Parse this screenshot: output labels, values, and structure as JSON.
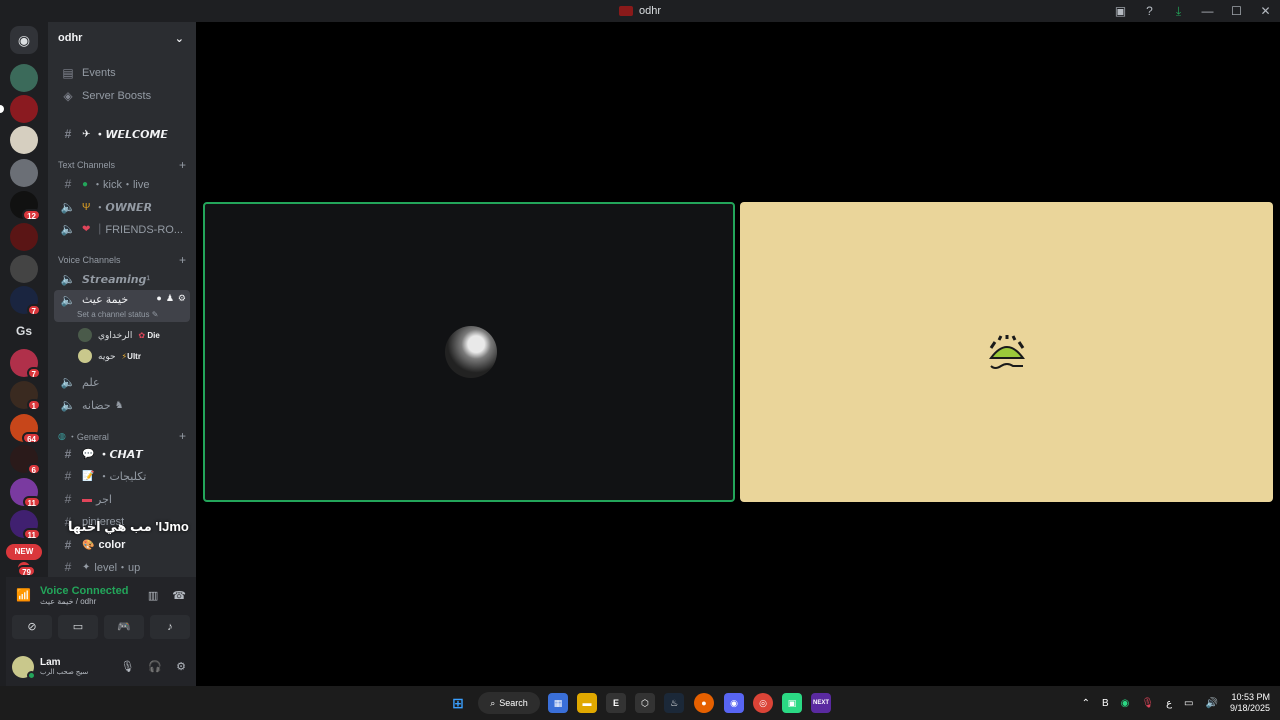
{
  "window": {
    "title": "odhr"
  },
  "server": {
    "name": "odhr"
  },
  "guilds": {
    "badges": [
      "12",
      "7",
      "7",
      "1",
      "64",
      "6",
      "11",
      "11",
      "79"
    ],
    "gs_label": "Gs",
    "new_label": "NEW"
  },
  "sidebar": {
    "events": "Events",
    "boosts": "Server Boosts",
    "welcome": "・𝙒𝙀𝙇𝘾𝙊𝙈𝙀",
    "text_category": "Text Channels",
    "text_channels": [
      "・kick・live",
      "・𝙊𝙒𝙉𝙀𝙍",
      "｜FRIENDS-RO..."
    ],
    "voice_category": "Voice Channels",
    "streaming": "𝙎𝙩𝙧𝙚𝙖𝙢𝙞𝙣𝙜¹",
    "active_voice": "خيمة عيث",
    "channel_status": "Set a channel status",
    "members": [
      {
        "name": "الرخداوي",
        "tag": "Die"
      },
      {
        "name": "حويه",
        "tag": "Ultr"
      }
    ],
    "voice_more": [
      "علم",
      "حضانه"
    ],
    "general_category": "・General",
    "general_channels": [
      "・𝘾𝙃𝘼𝙏",
      "・تكليجات",
      "اجر",
      "pinterest",
      "color",
      "level・up"
    ],
    "overlay_text": "مب هي اختها 'IJmo"
  },
  "voice_panel": {
    "status": "Voice Connected",
    "location": "خيمة عيث / odhr"
  },
  "user": {
    "name": "Lam",
    "status": "سيج صحب الرب"
  },
  "taskbar": {
    "search_label": "Search",
    "lang": "ع",
    "time": "10:53 PM",
    "date": "9/18/2025"
  },
  "colors": {
    "accent_green": "#23a55a",
    "tile_right_bg": "#ead59a",
    "danger": "#da373c"
  }
}
